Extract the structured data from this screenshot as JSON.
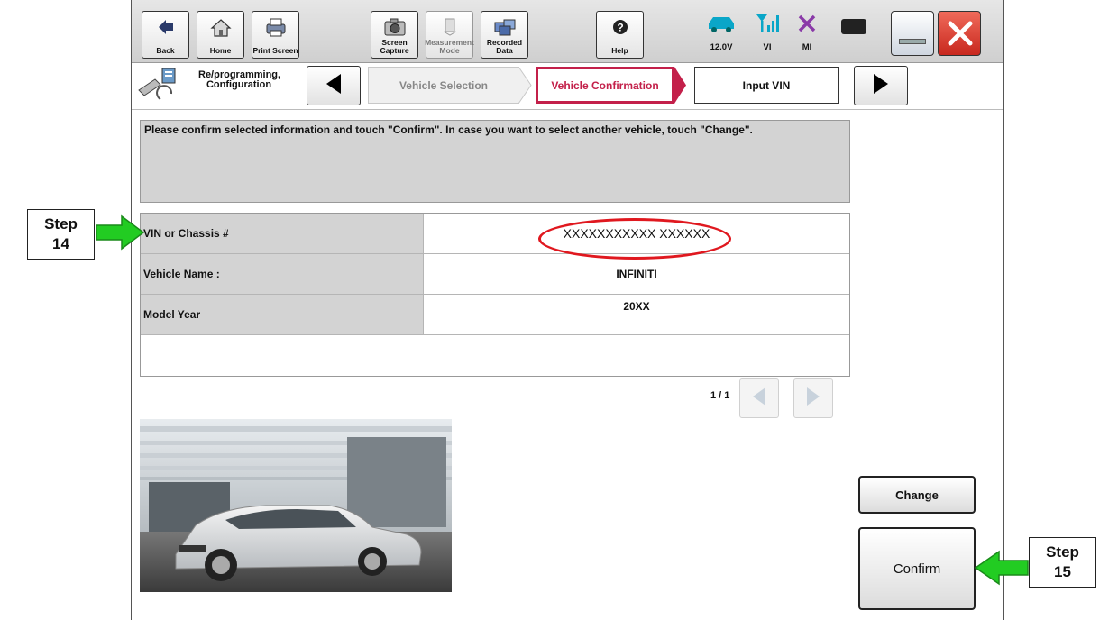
{
  "toolbar": {
    "back": "Back",
    "home": "Home",
    "print_screen": "Print Screen",
    "screen_capture": "Screen Capture",
    "measurement_mode": "Measurement Mode",
    "recorded_data": "Recorded Data",
    "help": "Help"
  },
  "status": {
    "voltage": "12.0V",
    "vi": "VI",
    "mi": "MI"
  },
  "breadcrumb": {
    "section_label": "Re/programming, Configuration",
    "steps": [
      "Vehicle Selection",
      "Vehicle Confirmation",
      "Input VIN"
    ],
    "active_step": "Vehicle Confirmation"
  },
  "message": "Please confirm selected information and touch \"Confirm\". In case you want to select another vehicle, touch \"Change\".",
  "vehicle_info": [
    {
      "label": "VIN or Chassis #",
      "value": "XXXXXXXXXXX XXXXXX"
    },
    {
      "label": "Vehicle Name :",
      "value": "INFINITI"
    },
    {
      "label": "Model Year",
      "value": "20XX"
    }
  ],
  "pager": {
    "text": "1 / 1"
  },
  "buttons": {
    "change": "Change",
    "confirm": "Confirm"
  },
  "annotations": {
    "step14": [
      "Step",
      "14"
    ],
    "step15": [
      "Step",
      "15"
    ]
  },
  "colors": {
    "active_crumb": "#c3204a",
    "annotation_arrow": "#22cc22",
    "highlight_oval": "#e0181f"
  }
}
